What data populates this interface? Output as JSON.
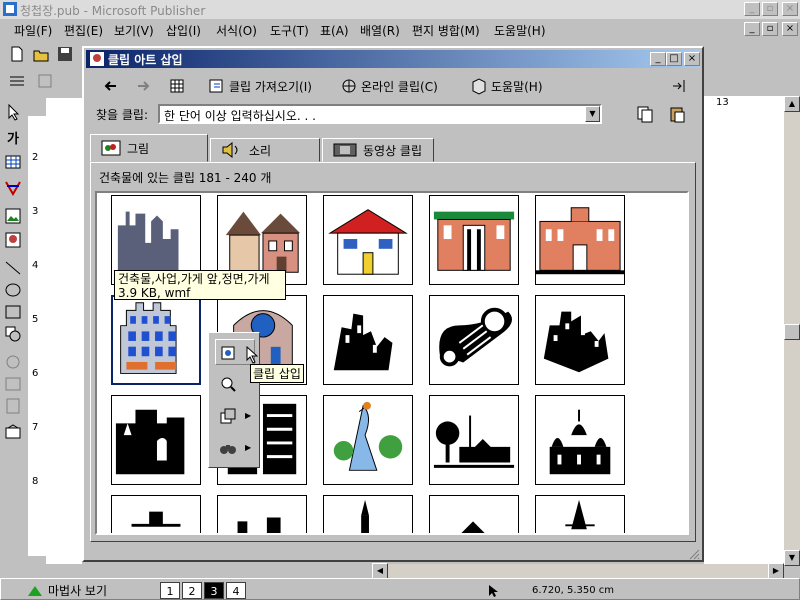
{
  "app": {
    "title": "청첩장.pub - Microsoft Publisher",
    "menu": [
      "파일(F)",
      "편집(E)",
      "보기(V)",
      "삽입(I)",
      "서식(O)",
      "도구(T)",
      "표(A)",
      "배열(R)",
      "편지 병합(M)",
      "도움말(H)"
    ]
  },
  "ruler": {
    "v_labels": [
      "2",
      "3",
      "4",
      "5",
      "6",
      "7",
      "8"
    ],
    "h_right_label": "13"
  },
  "dialog": {
    "title": "클립 아트 삽입",
    "toolbar": {
      "back": "back",
      "forward": "forward",
      "all_categories": "all-categories",
      "import_label": "클립 가져오기(I)",
      "online_label": "온라인 클립(C)",
      "help_label": "도움말(H)"
    },
    "search": {
      "label": "찾을 클립:",
      "value": "한 단어 이상 입력하십시오. . ."
    },
    "tabs": [
      {
        "label": "그림",
        "icon": "picture-icon"
      },
      {
        "label": "소리",
        "icon": "sound-icon"
      },
      {
        "label": "동영상 클립",
        "icon": "video-icon"
      }
    ],
    "results_title": "건축물에 있는 클립 181 - 240 개",
    "clips": [
      {
        "name": "clip-skyline"
      },
      {
        "name": "clip-victorian-house"
      },
      {
        "name": "clip-red-roof-house"
      },
      {
        "name": "clip-school"
      },
      {
        "name": "clip-brick-hall"
      },
      {
        "name": "clip-shopfront"
      },
      {
        "name": "clip-arched-building"
      },
      {
        "name": "clip-bw-city-tilted"
      },
      {
        "name": "clip-scroll-column"
      },
      {
        "name": "clip-bw-city-circle"
      },
      {
        "name": "clip-desert-town"
      },
      {
        "name": "clip-scaffold"
      },
      {
        "name": "clip-tower-tree"
      },
      {
        "name": "clip-farmhouse"
      },
      {
        "name": "clip-onion-domes"
      }
    ],
    "tooltip": {
      "line1": "건축물,사업,가게 앞,정면,가게",
      "line2": "3.9 KB, wmf"
    },
    "popup_tip": "클립 삽입",
    "colors": {
      "title_start": "#0a246a",
      "title_end": "#a6caf0"
    }
  },
  "status": {
    "wizard_label": "마법사 보기",
    "pages": [
      "1",
      "2",
      "3",
      "4"
    ],
    "active_page": "3",
    "coords": "6.720, 5.350 cm"
  }
}
